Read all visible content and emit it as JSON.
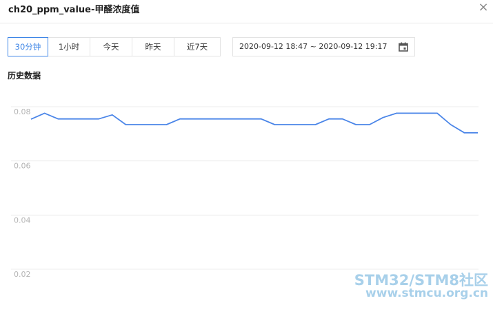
{
  "dialog": {
    "title": "ch20_ppm_value-甲醛浓度值",
    "close_glyph": "×",
    "close_icon": "close-icon"
  },
  "range_tabs": [
    {
      "label": "30分钟",
      "active": true
    },
    {
      "label": "1小时",
      "active": false
    },
    {
      "label": "今天",
      "active": false
    },
    {
      "label": "昨天",
      "active": false
    },
    {
      "label": "近7天",
      "active": false
    }
  ],
  "date_range": {
    "value": "2020-09-12 18:47 ~ 2020-09-12 19:17",
    "icon": "calendar-icon"
  },
  "section": {
    "title": "历史数据"
  },
  "colors": {
    "accent": "#3c84e6",
    "line": "#4a85e8",
    "grid": "#ececec",
    "axis_text": "#b3b3b3"
  },
  "chart_data": {
    "type": "line",
    "title": "",
    "xlabel": "",
    "ylabel": "",
    "ylim": [
      0.02,
      0.08
    ],
    "yticks": [
      "0.08",
      "0.06",
      "0.04",
      "0.02"
    ],
    "ytick_values": [
      0.08,
      0.06,
      0.04,
      0.02
    ],
    "grid": true,
    "series": [
      {
        "values": [
          0.0754,
          0.0776,
          0.0755,
          0.0755,
          0.0755,
          0.0755,
          0.077,
          0.0734,
          0.0734,
          0.0734,
          0.0734,
          0.0755,
          0.0755,
          0.0755,
          0.0755,
          0.0755,
          0.0755,
          0.0755,
          0.0734,
          0.0734,
          0.0734,
          0.0734,
          0.0755,
          0.0755,
          0.0734,
          0.0734,
          0.076,
          0.0776,
          0.0776,
          0.0776,
          0.0776,
          0.0734,
          0.0704,
          0.0704
        ]
      }
    ]
  },
  "watermark": {
    "line1": "STM32/STM8社区",
    "line2": "www.stmcu.org.cn"
  }
}
